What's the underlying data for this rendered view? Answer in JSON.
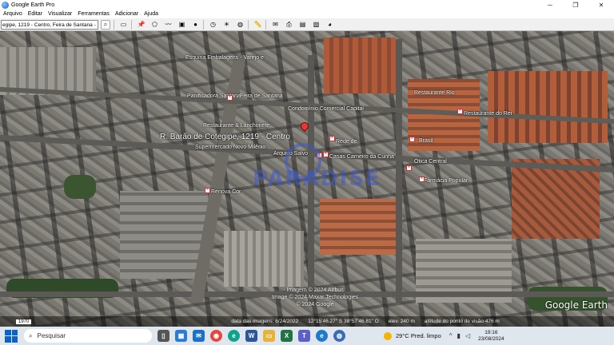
{
  "window": {
    "title": "Google Earth Pro",
    "minimize": "─",
    "maximize": "❐",
    "close": "✕"
  },
  "menu": [
    "Arquivo",
    "Editar",
    "Visualizar",
    "Ferramentas",
    "Adicionar",
    "Ajuda"
  ],
  "search": {
    "value": "egipe, 1219 - Centro, Feira de Santana - BA"
  },
  "map": {
    "main_label": "R. Barão de Cotegipe, 1219 - Centro",
    "labels": [
      "Esquina Embalagens - Varejo e",
      "Panificadora Santana",
      "Feira de Santana",
      "Restaurante & Lanchonete",
      "Condomínio Comercial Capital",
      "Restaurante Rio",
      "Supermercado Novo Milênio",
      "Restaurante do Rei",
      "Brasil",
      "Arquivo Salvo",
      "Rede de",
      "Renova Cor",
      "Casas Carneiro da Cunha",
      "Ótica Central",
      "Farmácia Popular"
    ],
    "watermark": "PARADISE",
    "copyright": [
      "Imagem © 2024 Airbus",
      "Image © 2024 Maxar Technologies",
      "© 2024 Google"
    ],
    "logo": "Google Earth"
  },
  "status": {
    "year": "1970",
    "imagery_date": "data das imagens: 6/24/2022",
    "coords": "12°15'46.27\" S  38°57'46.81\" O",
    "elev": "elev. 240 m",
    "eye": "altitude do ponto de visão  476 m"
  },
  "taskbar": {
    "search_placeholder": "Pesquisar",
    "weather": "29°C  Pred. limpo",
    "time": "19:16",
    "date": "23/08/2024"
  }
}
